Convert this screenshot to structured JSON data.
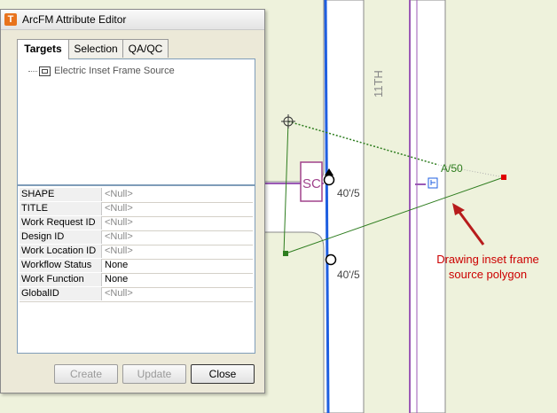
{
  "window": {
    "title": "ArcFM Attribute Editor",
    "app_icon_glyph": "T",
    "app_icon_name": "arcfm-app-icon"
  },
  "tabs": [
    {
      "label": "Targets",
      "active": true
    },
    {
      "label": "Selection",
      "active": false
    },
    {
      "label": "QA/QC",
      "active": false
    }
  ],
  "tree": {
    "node_label": "Electric Inset Frame Source",
    "node_icon": "inset-frame-icon"
  },
  "attributes": [
    {
      "name": "SHAPE",
      "value": "<Null>"
    },
    {
      "name": "TITLE",
      "value": "<Null>"
    },
    {
      "name": "Work Request ID",
      "value": "<Null>"
    },
    {
      "name": "Design ID",
      "value": "<Null>"
    },
    {
      "name": "Work Location ID",
      "value": "<Null>"
    },
    {
      "name": "Workflow Status",
      "value": "None"
    },
    {
      "name": "Work Function",
      "value": "None"
    },
    {
      "name": "GlobalID",
      "value": "<Null>"
    }
  ],
  "buttons": {
    "create": "Create",
    "update": "Update",
    "close": "Close"
  },
  "map": {
    "street_label": "11TH",
    "symbol_label": "SC",
    "span_label_1": "40'/5",
    "span_label_2": "40'/5",
    "transformer_label": "A/50",
    "annotation": [
      "Drawing inset frame",
      "source polygon"
    ],
    "colors": {
      "background": "#eef2dc",
      "road_fill": "#ffffff",
      "road_edge": "#8a8a8a",
      "primary_line": "#1f5fe0",
      "secondary_line": "#9b59b6",
      "frame_polygon": "#2e7d1f",
      "annotation_text": "#cc0000",
      "arrow": "#b71c1c"
    }
  }
}
